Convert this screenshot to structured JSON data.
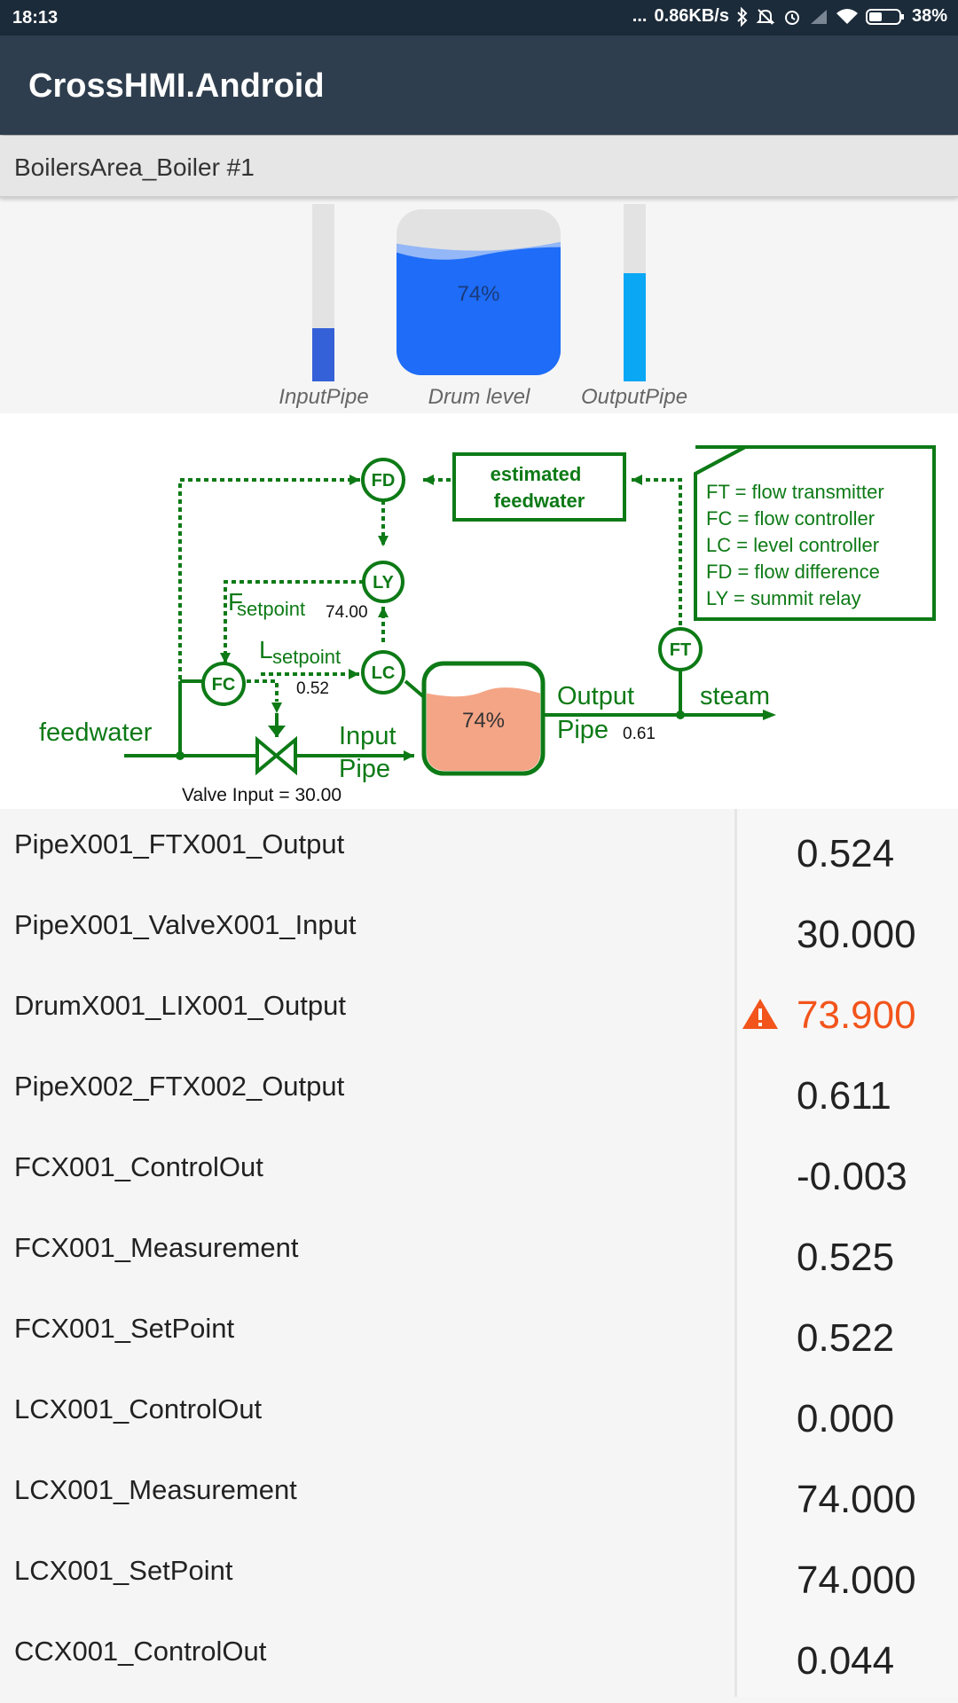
{
  "status_bar": {
    "time": "18:13",
    "dots": "...",
    "speed": "0.86KB/s",
    "battery": "38%",
    "icons": [
      "bluetooth-icon",
      "mute-icon",
      "alarm-icon",
      "signal-icon",
      "wifi-icon",
      "battery-icon"
    ]
  },
  "app_bar": {
    "title": "CrossHMI.Android"
  },
  "breadcrumb": {
    "label": "BoilersArea_Boiler #1"
  },
  "gauges": {
    "input_pipe": {
      "label": "InputPipe",
      "level": 0.3,
      "color": "#3561d8"
    },
    "drum": {
      "label": "Drum level",
      "value_text": "74%",
      "level": 0.74,
      "color": "#1e6cf7"
    },
    "output_pipe": {
      "label": "OutputPipe",
      "level": 0.61,
      "color": "#0aa7f5"
    }
  },
  "diagram": {
    "estimated_line1": "estimated",
    "estimated_line2": "feedwater",
    "legend": [
      "FT = flow transmitter",
      "FC = flow controller",
      "LC = level controller",
      "FD = flow difference",
      "LY = summit relay"
    ],
    "fd": "FD",
    "ly": "LY",
    "fc": "FC",
    "lc": "LC",
    "ft": "FT",
    "f_setpoint_prefix": "F",
    "f_setpoint_sub": "setpoint",
    "f_setpoint_value": "74.00",
    "l_setpoint_prefix": "L",
    "l_setpoint_sub": "setpoint",
    "l_setpoint_value": "0.52",
    "feedwater": "feedwater",
    "input_line1": "Input",
    "input_line2": "Pipe",
    "output_line1": "Output",
    "output_line2": "Pipe",
    "output_value": "0.61",
    "steam": "steam",
    "tank_level_text": "74%",
    "tank_level": 0.74,
    "valve_input": "Valve Input = 30.00",
    "color_line": "#0d7a16",
    "color_tank": "#f4a586"
  },
  "table": {
    "rows": [
      {
        "name": "PipeX001_FTX001_Output",
        "value": "0.524",
        "alarm": false
      },
      {
        "name": "PipeX001_ValveX001_Input",
        "value": "30.000",
        "alarm": false
      },
      {
        "name": "DrumX001_LIX001_Output",
        "value": "73.900",
        "alarm": true
      },
      {
        "name": "PipeX002_FTX002_Output",
        "value": "0.611",
        "alarm": false
      },
      {
        "name": "FCX001_ControlOut",
        "value": "-0.003",
        "alarm": false
      },
      {
        "name": "FCX001_Measurement",
        "value": "0.525",
        "alarm": false
      },
      {
        "name": "FCX001_SetPoint",
        "value": "0.522",
        "alarm": false
      },
      {
        "name": "LCX001_ControlOut",
        "value": "0.000",
        "alarm": false
      },
      {
        "name": "LCX001_Measurement",
        "value": "74.000",
        "alarm": false
      },
      {
        "name": "LCX001_SetPoint",
        "value": "74.000",
        "alarm": false
      },
      {
        "name": "CCX001_ControlOut",
        "value": "0.044",
        "alarm": false
      }
    ],
    "alarm_color": "#f2541b"
  }
}
